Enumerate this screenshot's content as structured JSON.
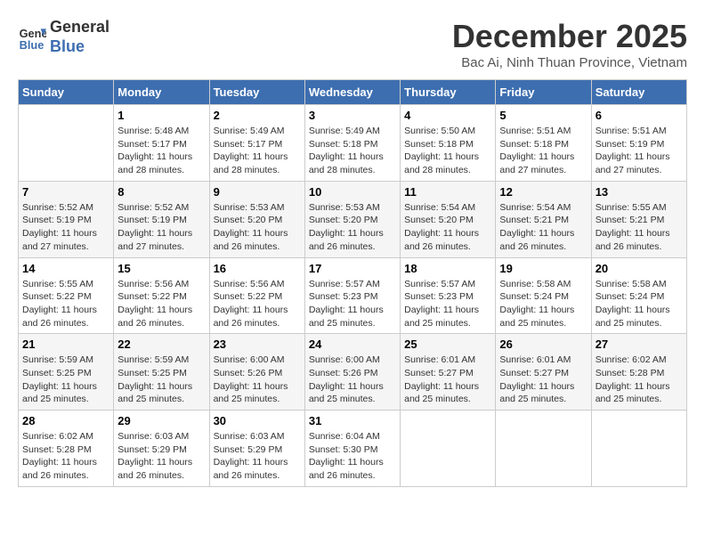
{
  "logo": {
    "line1": "General",
    "line2": "Blue"
  },
  "title": "December 2025",
  "subtitle": "Bac Ai, Ninh Thuan Province, Vietnam",
  "weekdays": [
    "Sunday",
    "Monday",
    "Tuesday",
    "Wednesday",
    "Thursday",
    "Friday",
    "Saturday"
  ],
  "weeks": [
    [
      {
        "day": "",
        "sunrise": "",
        "sunset": "",
        "daylight": ""
      },
      {
        "day": "1",
        "sunrise": "Sunrise: 5:48 AM",
        "sunset": "Sunset: 5:17 PM",
        "daylight": "Daylight: 11 hours and 28 minutes."
      },
      {
        "day": "2",
        "sunrise": "Sunrise: 5:49 AM",
        "sunset": "Sunset: 5:17 PM",
        "daylight": "Daylight: 11 hours and 28 minutes."
      },
      {
        "day": "3",
        "sunrise": "Sunrise: 5:49 AM",
        "sunset": "Sunset: 5:18 PM",
        "daylight": "Daylight: 11 hours and 28 minutes."
      },
      {
        "day": "4",
        "sunrise": "Sunrise: 5:50 AM",
        "sunset": "Sunset: 5:18 PM",
        "daylight": "Daylight: 11 hours and 28 minutes."
      },
      {
        "day": "5",
        "sunrise": "Sunrise: 5:51 AM",
        "sunset": "Sunset: 5:18 PM",
        "daylight": "Daylight: 11 hours and 27 minutes."
      },
      {
        "day": "6",
        "sunrise": "Sunrise: 5:51 AM",
        "sunset": "Sunset: 5:19 PM",
        "daylight": "Daylight: 11 hours and 27 minutes."
      }
    ],
    [
      {
        "day": "7",
        "sunrise": "Sunrise: 5:52 AM",
        "sunset": "Sunset: 5:19 PM",
        "daylight": "Daylight: 11 hours and 27 minutes."
      },
      {
        "day": "8",
        "sunrise": "Sunrise: 5:52 AM",
        "sunset": "Sunset: 5:19 PM",
        "daylight": "Daylight: 11 hours and 27 minutes."
      },
      {
        "day": "9",
        "sunrise": "Sunrise: 5:53 AM",
        "sunset": "Sunset: 5:20 PM",
        "daylight": "Daylight: 11 hours and 26 minutes."
      },
      {
        "day": "10",
        "sunrise": "Sunrise: 5:53 AM",
        "sunset": "Sunset: 5:20 PM",
        "daylight": "Daylight: 11 hours and 26 minutes."
      },
      {
        "day": "11",
        "sunrise": "Sunrise: 5:54 AM",
        "sunset": "Sunset: 5:20 PM",
        "daylight": "Daylight: 11 hours and 26 minutes."
      },
      {
        "day": "12",
        "sunrise": "Sunrise: 5:54 AM",
        "sunset": "Sunset: 5:21 PM",
        "daylight": "Daylight: 11 hours and 26 minutes."
      },
      {
        "day": "13",
        "sunrise": "Sunrise: 5:55 AM",
        "sunset": "Sunset: 5:21 PM",
        "daylight": "Daylight: 11 hours and 26 minutes."
      }
    ],
    [
      {
        "day": "14",
        "sunrise": "Sunrise: 5:55 AM",
        "sunset": "Sunset: 5:22 PM",
        "daylight": "Daylight: 11 hours and 26 minutes."
      },
      {
        "day": "15",
        "sunrise": "Sunrise: 5:56 AM",
        "sunset": "Sunset: 5:22 PM",
        "daylight": "Daylight: 11 hours and 26 minutes."
      },
      {
        "day": "16",
        "sunrise": "Sunrise: 5:56 AM",
        "sunset": "Sunset: 5:22 PM",
        "daylight": "Daylight: 11 hours and 26 minutes."
      },
      {
        "day": "17",
        "sunrise": "Sunrise: 5:57 AM",
        "sunset": "Sunset: 5:23 PM",
        "daylight": "Daylight: 11 hours and 25 minutes."
      },
      {
        "day": "18",
        "sunrise": "Sunrise: 5:57 AM",
        "sunset": "Sunset: 5:23 PM",
        "daylight": "Daylight: 11 hours and 25 minutes."
      },
      {
        "day": "19",
        "sunrise": "Sunrise: 5:58 AM",
        "sunset": "Sunset: 5:24 PM",
        "daylight": "Daylight: 11 hours and 25 minutes."
      },
      {
        "day": "20",
        "sunrise": "Sunrise: 5:58 AM",
        "sunset": "Sunset: 5:24 PM",
        "daylight": "Daylight: 11 hours and 25 minutes."
      }
    ],
    [
      {
        "day": "21",
        "sunrise": "Sunrise: 5:59 AM",
        "sunset": "Sunset: 5:25 PM",
        "daylight": "Daylight: 11 hours and 25 minutes."
      },
      {
        "day": "22",
        "sunrise": "Sunrise: 5:59 AM",
        "sunset": "Sunset: 5:25 PM",
        "daylight": "Daylight: 11 hours and 25 minutes."
      },
      {
        "day": "23",
        "sunrise": "Sunrise: 6:00 AM",
        "sunset": "Sunset: 5:26 PM",
        "daylight": "Daylight: 11 hours and 25 minutes."
      },
      {
        "day": "24",
        "sunrise": "Sunrise: 6:00 AM",
        "sunset": "Sunset: 5:26 PM",
        "daylight": "Daylight: 11 hours and 25 minutes."
      },
      {
        "day": "25",
        "sunrise": "Sunrise: 6:01 AM",
        "sunset": "Sunset: 5:27 PM",
        "daylight": "Daylight: 11 hours and 25 minutes."
      },
      {
        "day": "26",
        "sunrise": "Sunrise: 6:01 AM",
        "sunset": "Sunset: 5:27 PM",
        "daylight": "Daylight: 11 hours and 25 minutes."
      },
      {
        "day": "27",
        "sunrise": "Sunrise: 6:02 AM",
        "sunset": "Sunset: 5:28 PM",
        "daylight": "Daylight: 11 hours and 25 minutes."
      }
    ],
    [
      {
        "day": "28",
        "sunrise": "Sunrise: 6:02 AM",
        "sunset": "Sunset: 5:28 PM",
        "daylight": "Daylight: 11 hours and 26 minutes."
      },
      {
        "day": "29",
        "sunrise": "Sunrise: 6:03 AM",
        "sunset": "Sunset: 5:29 PM",
        "daylight": "Daylight: 11 hours and 26 minutes."
      },
      {
        "day": "30",
        "sunrise": "Sunrise: 6:03 AM",
        "sunset": "Sunset: 5:29 PM",
        "daylight": "Daylight: 11 hours and 26 minutes."
      },
      {
        "day": "31",
        "sunrise": "Sunrise: 6:04 AM",
        "sunset": "Sunset: 5:30 PM",
        "daylight": "Daylight: 11 hours and 26 minutes."
      },
      {
        "day": "",
        "sunrise": "",
        "sunset": "",
        "daylight": ""
      },
      {
        "day": "",
        "sunrise": "",
        "sunset": "",
        "daylight": ""
      },
      {
        "day": "",
        "sunrise": "",
        "sunset": "",
        "daylight": ""
      }
    ]
  ]
}
